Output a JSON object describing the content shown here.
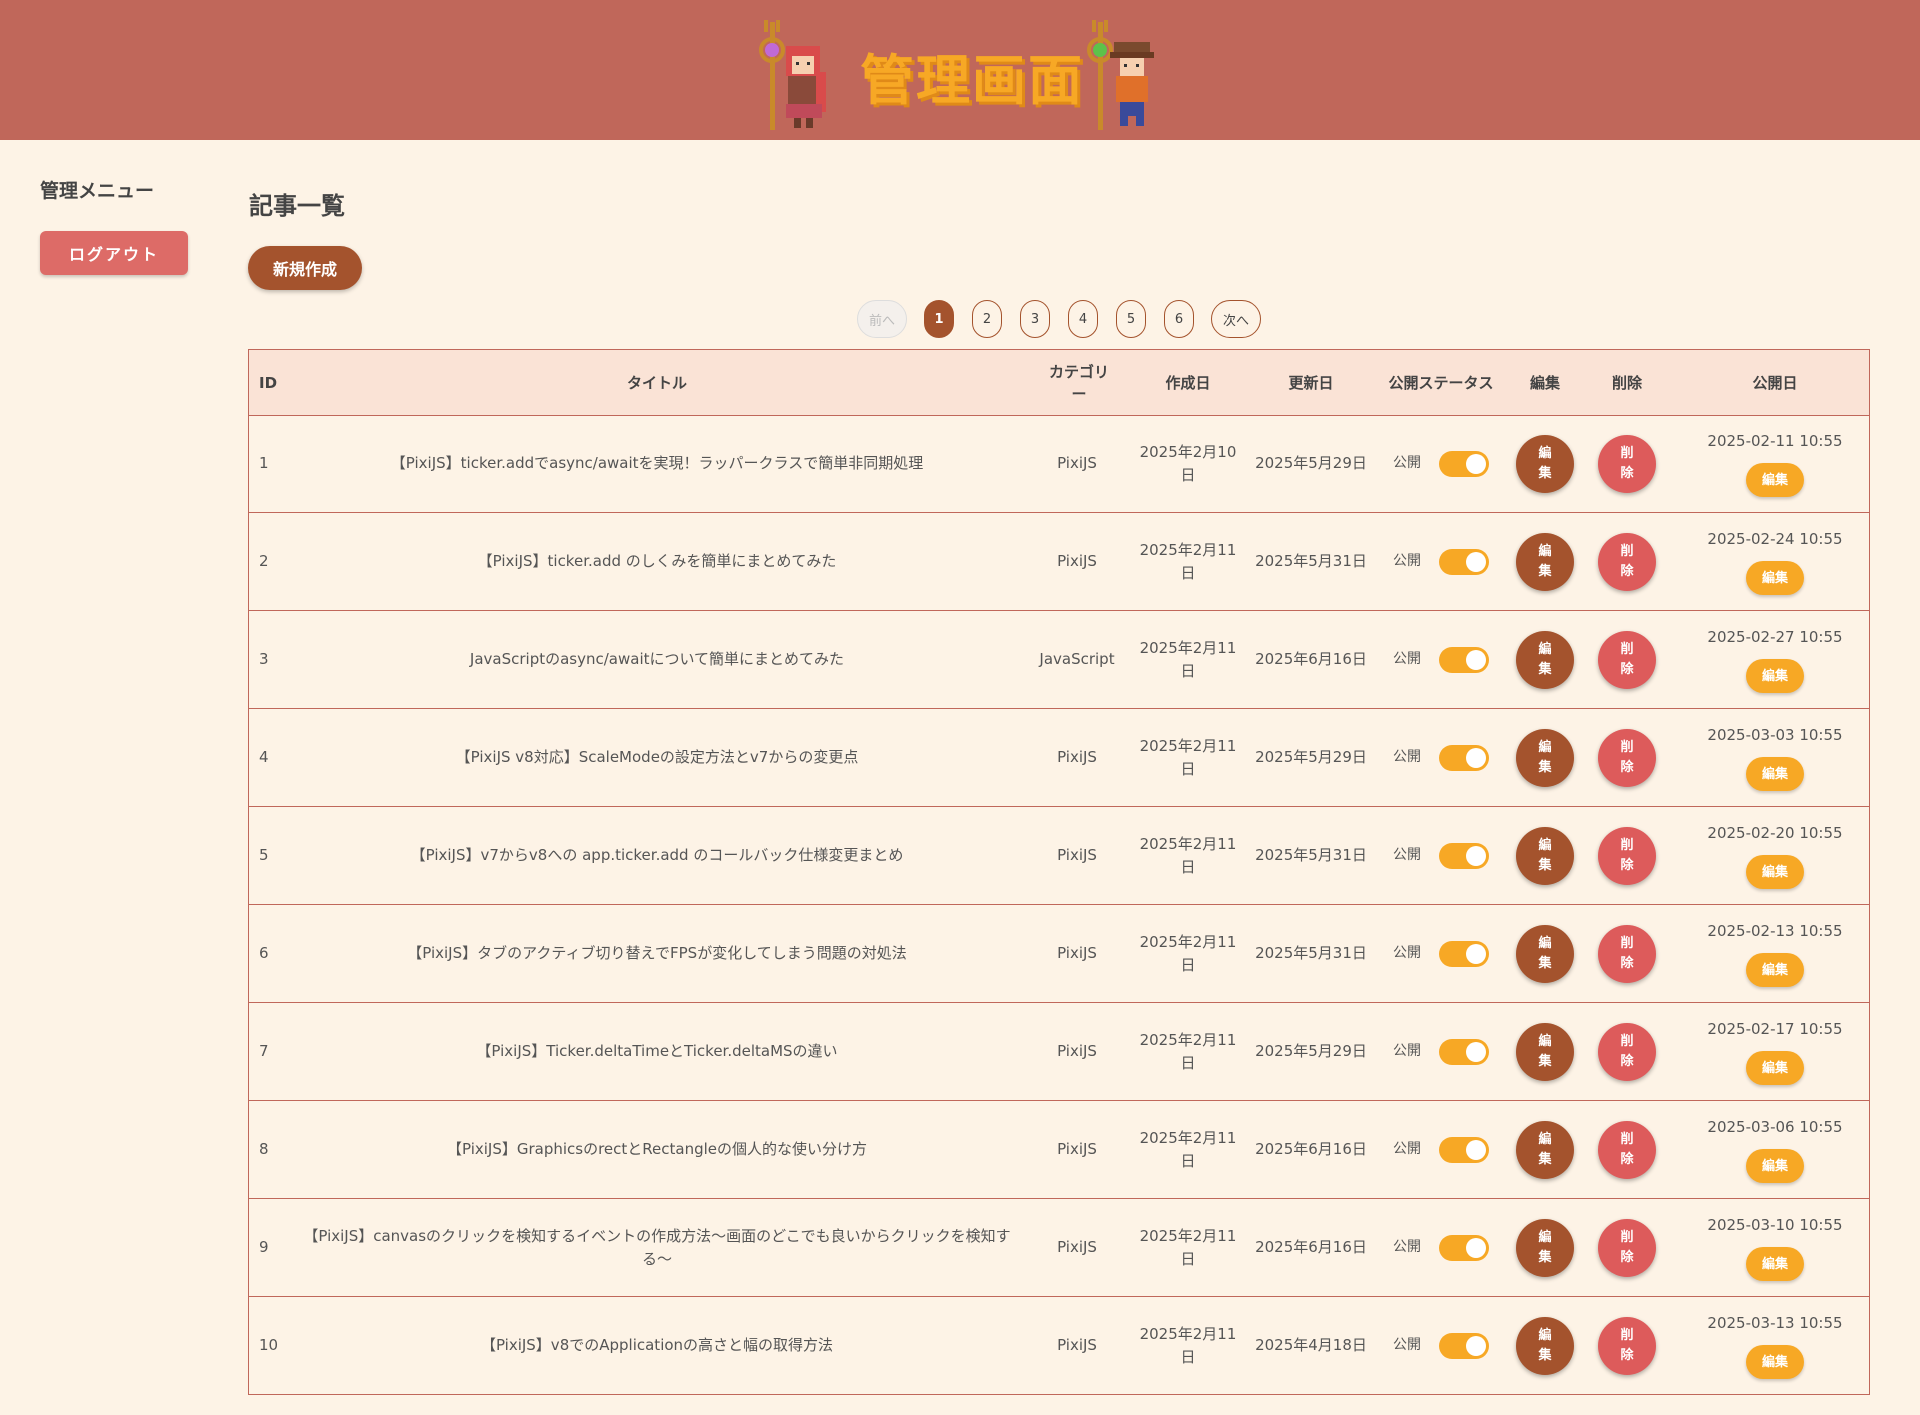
{
  "header": {
    "title": "管理画面"
  },
  "sidebar": {
    "title": "管理メニュー",
    "logout_label": "ログアウト"
  },
  "main": {
    "title": "記事一覧",
    "new_label": "新規作成"
  },
  "pagination": {
    "prev": "前へ",
    "next": "次へ",
    "pages": [
      "1",
      "2",
      "3",
      "4",
      "5",
      "6"
    ],
    "current": "1"
  },
  "table": {
    "headers": {
      "id": "ID",
      "title": "タイトル",
      "category": "カテゴリー",
      "created": "作成日",
      "updated": "更新日",
      "status": "公開ステータス",
      "edit": "編集",
      "delete": "削除",
      "published": "公開日"
    },
    "rows": [
      {
        "id": "1",
        "title": "【PixiJS】ticker.addでasync/awaitを実現！ラッパークラスで簡単非同期処理",
        "category": "PixiJS",
        "created": "2025年2月10日",
        "updated": "2025年5月29日",
        "status": "公開",
        "edit": "編集",
        "delete": "削除",
        "published": "2025-02-11 10:55",
        "pub_edit": "編集"
      },
      {
        "id": "2",
        "title": "【PixiJS】ticker.add のしくみを簡単にまとめてみた",
        "category": "PixiJS",
        "created": "2025年2月11日",
        "updated": "2025年5月31日",
        "status": "公開",
        "edit": "編集",
        "delete": "削除",
        "published": "2025-02-24 10:55",
        "pub_edit": "編集"
      },
      {
        "id": "3",
        "title": "JavaScriptのasync/awaitについて簡単にまとめてみた",
        "category": "JavaScript",
        "created": "2025年2月11日",
        "updated": "2025年6月16日",
        "status": "公開",
        "edit": "編集",
        "delete": "削除",
        "published": "2025-02-27 10:55",
        "pub_edit": "編集"
      },
      {
        "id": "4",
        "title": "【PixiJS v8対応】ScaleModeの設定方法とv7からの変更点",
        "category": "PixiJS",
        "created": "2025年2月11日",
        "updated": "2025年5月29日",
        "status": "公開",
        "edit": "編集",
        "delete": "削除",
        "published": "2025-03-03 10:55",
        "pub_edit": "編集"
      },
      {
        "id": "5",
        "title": "【PixiJS】v7からv8への app.ticker.add のコールバック仕様変更まとめ",
        "category": "PixiJS",
        "created": "2025年2月11日",
        "updated": "2025年5月31日",
        "status": "公開",
        "edit": "編集",
        "delete": "削除",
        "published": "2025-02-20 10:55",
        "pub_edit": "編集"
      },
      {
        "id": "6",
        "title": "【PixiJS】タブのアクティブ切り替えでFPSが変化してしまう問題の対処法",
        "category": "PixiJS",
        "created": "2025年2月11日",
        "updated": "2025年5月31日",
        "status": "公開",
        "edit": "編集",
        "delete": "削除",
        "published": "2025-02-13 10:55",
        "pub_edit": "編集"
      },
      {
        "id": "7",
        "title": "【PixiJS】Ticker.deltaTimeとTicker.deltaMSの違い",
        "category": "PixiJS",
        "created": "2025年2月11日",
        "updated": "2025年5月29日",
        "status": "公開",
        "edit": "編集",
        "delete": "削除",
        "published": "2025-02-17 10:55",
        "pub_edit": "編集"
      },
      {
        "id": "8",
        "title": "【PixiJS】GraphicsのrectとRectangleの個人的な使い分け方",
        "category": "PixiJS",
        "created": "2025年2月11日",
        "updated": "2025年6月16日",
        "status": "公開",
        "edit": "編集",
        "delete": "削除",
        "published": "2025-03-06 10:55",
        "pub_edit": "編集"
      },
      {
        "id": "9",
        "title": "【PixiJS】canvasのクリックを検知するイベントの作成方法〜画面のどこでも良いからクリックを検知する〜",
        "category": "PixiJS",
        "created": "2025年2月11日",
        "updated": "2025年6月16日",
        "status": "公開",
        "edit": "編集",
        "delete": "削除",
        "published": "2025-03-10 10:55",
        "pub_edit": "編集"
      },
      {
        "id": "10",
        "title": "【PixiJS】v8でのApplicationの高さと幅の取得方法",
        "category": "PixiJS",
        "created": "2025年2月11日",
        "updated": "2025年4月18日",
        "status": "公開",
        "edit": "編集",
        "delete": "削除",
        "published": "2025-03-13 10:55",
        "pub_edit": "編集"
      }
    ]
  },
  "colors": {
    "header_bg": "#c0675a",
    "page_bg": "#fdf3e6",
    "title_orange": "#f7a825",
    "brown": "#a4532d",
    "red": "#dd5b5b",
    "table_header_bg": "#fae3d6"
  },
  "icons": {
    "mascot_left": "witch-girl-icon",
    "mascot_right": "adventurer-icon"
  }
}
